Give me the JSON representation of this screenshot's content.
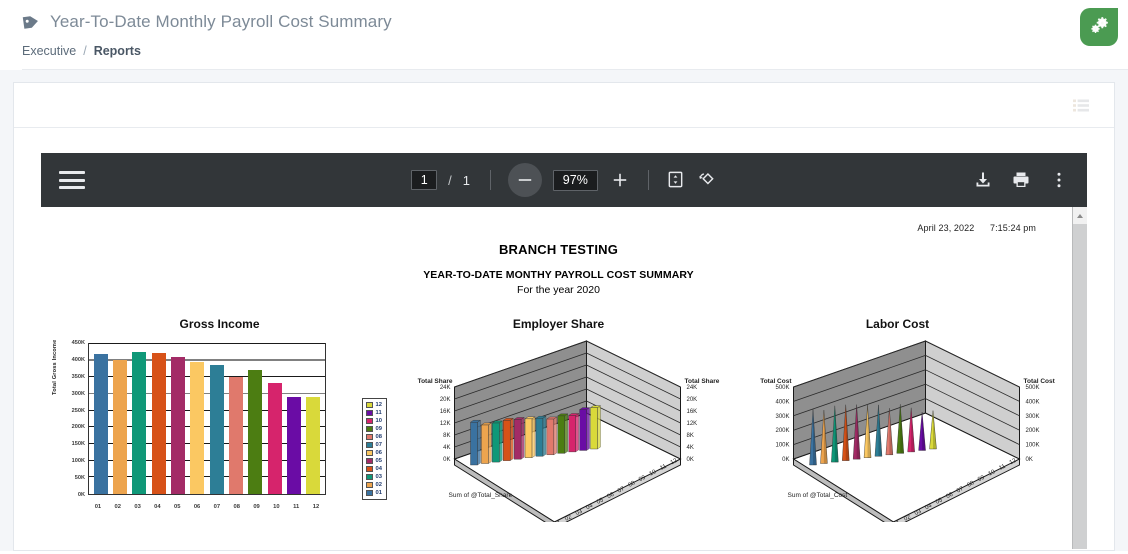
{
  "header": {
    "tag_icon": "tag-icon",
    "title": "Year-To-Date Monthly Payroll Cost Summary",
    "breadcrumb": {
      "parent": "Executive",
      "separator": "/",
      "current": "Reports"
    },
    "fab_icon": "gears-icon",
    "fab_color": "#4b9b52"
  },
  "card": {
    "menu_icon": "list-icon"
  },
  "viewer": {
    "menu_icon": "hamburger-icon",
    "page_current": "1",
    "page_separator": "/",
    "page_total": "1",
    "zoom_out_icon": "minus-icon",
    "zoom_level": "97%",
    "zoom_in_icon": "plus-icon",
    "fit_page_icon": "fit-page-icon",
    "rotate_icon": "rotate-icon",
    "download_icon": "download-icon",
    "print_icon": "print-icon",
    "more_icon": "more-vertical-icon",
    "toolbar_bg": "#323639"
  },
  "document": {
    "stamp_date": "April 23, 2022",
    "stamp_time": "7:15:24 pm",
    "company": "BRANCH TESTING",
    "report_title": "YEAR-TO-DATE MONTHY PAYROLL COST SUMMARY",
    "report_subtitle": "For the year 2020"
  },
  "chart_data": [
    {
      "type": "bar",
      "title": "Gross Income",
      "xlabel": "",
      "ylabel": "Total Gross Income",
      "categories": [
        "01",
        "02",
        "03",
        "04",
        "05",
        "06",
        "07",
        "08",
        "09",
        "10",
        "11",
        "12"
      ],
      "values": [
        420000,
        403000,
        425000,
        422000,
        412000,
        397000,
        388000,
        352000,
        371000,
        333000,
        290000,
        290000
      ],
      "ylim": [
        0,
        450000
      ],
      "yticks": [
        "0K",
        "50K",
        "100K",
        "150K",
        "200K",
        "250K",
        "300K",
        "350K",
        "400K",
        "450K"
      ],
      "colors": [
        "#3a72a0",
        "#eda44e",
        "#0f9878",
        "#d75218",
        "#a32b66",
        "#fbc862",
        "#2d7e96",
        "#e0796c",
        "#4c7d12",
        "#d6246c",
        "#6a0ca5",
        "#d9d93a"
      ],
      "grid": true,
      "legend_position": "right",
      "legend": [
        {
          "label": "12",
          "color": "#d9d93a"
        },
        {
          "label": "11",
          "color": "#6a0ca5"
        },
        {
          "label": "10",
          "color": "#d6246c"
        },
        {
          "label": "09",
          "color": "#4c7d12"
        },
        {
          "label": "08",
          "color": "#e0796c"
        },
        {
          "label": "07",
          "color": "#2d7e96"
        },
        {
          "label": "06",
          "color": "#fbc862"
        },
        {
          "label": "05",
          "color": "#a32b66"
        },
        {
          "label": "04",
          "color": "#d75218"
        },
        {
          "label": "03",
          "color": "#0f9878"
        },
        {
          "label": "02",
          "color": "#eda44e"
        },
        {
          "label": "01",
          "color": "#3a72a0"
        }
      ]
    },
    {
      "type": "bar",
      "render": "3d-bars",
      "title": "Employer Share",
      "axis_label_left": "Total Share",
      "axis_label_right": "Total Share",
      "footer": "Sum of @Total_Share",
      "categories": [
        "01",
        "02",
        "03",
        "04",
        "05",
        "06",
        "07",
        "08",
        "09",
        "10",
        "11",
        "12"
      ],
      "values": [
        15500,
        14000,
        14200,
        14600,
        14400,
        14100,
        13800,
        13000,
        13600,
        13200,
        14800,
        15000
      ],
      "ylim": [
        0,
        24000
      ],
      "yticks": [
        "0K",
        "4K",
        "8K",
        "12K",
        "16K",
        "20K",
        "24K"
      ],
      "colors": [
        "#3a72a0",
        "#eda44e",
        "#0f9878",
        "#d75218",
        "#a32b66",
        "#fbc862",
        "#2d7e96",
        "#e0796c",
        "#4c7d12",
        "#d6246c",
        "#6a0ca5",
        "#d9d93a"
      ]
    },
    {
      "type": "bar",
      "render": "3d-cones",
      "title": "Labor Cost",
      "axis_label_left": "Total Cost",
      "axis_label_right": "Total Cost",
      "footer": "Sum of @Total_Cost",
      "categories": [
        "01",
        "02",
        "03",
        "04",
        "05",
        "06",
        "07",
        "08",
        "09",
        "10",
        "11",
        "12"
      ],
      "values": [
        420000,
        403000,
        425000,
        422000,
        412000,
        397000,
        388000,
        352000,
        371000,
        333000,
        290000,
        290000
      ],
      "ylim": [
        0,
        500000
      ],
      "yticks": [
        "0K",
        "100K",
        "200K",
        "300K",
        "400K",
        "500K"
      ],
      "colors": [
        "#3a72a0",
        "#eda44e",
        "#0f9878",
        "#d75218",
        "#a32b66",
        "#fbc862",
        "#2d7e96",
        "#e0796c",
        "#4c7d12",
        "#d6246c",
        "#6a0ca5",
        "#d9d93a"
      ]
    }
  ]
}
